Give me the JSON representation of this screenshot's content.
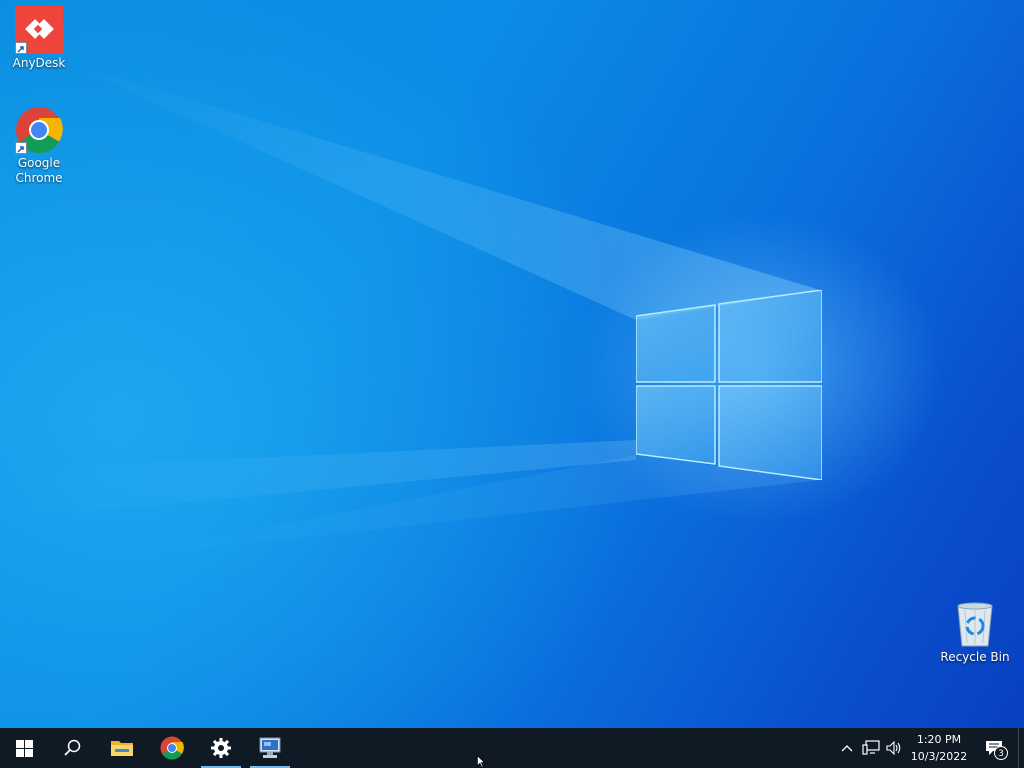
{
  "desktop": {
    "icons": [
      {
        "label": "AnyDesk",
        "icon": "anydesk-icon",
        "shortcut": true
      },
      {
        "label": "Google Chrome",
        "icon": "chrome-icon",
        "shortcut": true
      },
      {
        "label": "Recycle Bin",
        "icon": "recycle-bin-icon",
        "shortcut": false
      }
    ]
  },
  "taskbar": {
    "pinned": [
      {
        "name": "start-button",
        "icon": "windows-logo-icon",
        "active": false
      },
      {
        "name": "search-button",
        "icon": "search-icon",
        "active": false
      },
      {
        "name": "file-explorer-button",
        "icon": "folder-icon",
        "active": false
      },
      {
        "name": "chrome-button",
        "icon": "chrome-icon",
        "active": false
      },
      {
        "name": "settings-button",
        "icon": "gear-icon",
        "active": true
      },
      {
        "name": "remote-desktop-button",
        "icon": "remote-desktop-icon",
        "active": true
      }
    ],
    "tray": {
      "icons": [
        "chevron-up-icon",
        "network-icon",
        "volume-icon"
      ],
      "time": "1:20 PM",
      "date": "10/3/2022",
      "notification_count": "3"
    }
  },
  "colors": {
    "taskbar_bg": "#101a24",
    "accent": "#76b9ed",
    "anydesk_red": "#ef443b"
  }
}
